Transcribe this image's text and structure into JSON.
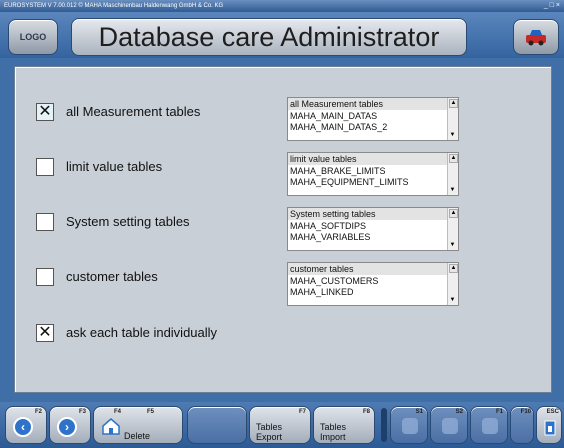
{
  "window": {
    "titlebar": "EUROSYSTEM V 7.00.012 © MAHA Maschinenbau Haldenwang GmbH & Co. KG",
    "controls": "_ □ ×"
  },
  "header": {
    "logo_label": "LOGO",
    "title": "Database care Administrator",
    "car_icon": "car-icon"
  },
  "options": [
    {
      "checked": true,
      "mark": "✕",
      "label": "all Measurement tables",
      "list_header": "all Measurement tables",
      "list_items": [
        "MAHA_MAIN_DATAS",
        "MAHA_MAIN_DATAS_2"
      ]
    },
    {
      "checked": false,
      "mark": "",
      "label": "limit value tables",
      "list_header": "limit value tables",
      "list_items": [
        "MAHA_BRAKE_LIMITS",
        "MAHA_EQUIPMENT_LIMITS"
      ]
    },
    {
      "checked": false,
      "mark": "",
      "label": "System setting tables",
      "list_header": "System setting tables",
      "list_items": [
        "MAHA_SOFTDIPS",
        "MAHA_VARIABLES"
      ]
    },
    {
      "checked": false,
      "mark": "",
      "label": "customer tables",
      "list_header": "customer tables",
      "list_items": [
        "MAHA_CUSTOMERS",
        "MAHA_LINKED"
      ]
    }
  ],
  "ask_each": {
    "checked": true,
    "mark": "✕",
    "label": "ask each table individually"
  },
  "footer": {
    "f2": {
      "key": "F2",
      "icon": "back-arrow-icon",
      "glyph": "‹"
    },
    "f3": {
      "key": "F3",
      "icon": "forward-arrow-icon",
      "glyph": "›"
    },
    "f4": {
      "key": "F4",
      "icon": "home-icon"
    },
    "f5": {
      "key": "F5",
      "label": "Delete"
    },
    "f7": {
      "key": "F7",
      "label1": "Tables",
      "label2": "Export"
    },
    "f8": {
      "key": "F8",
      "label1": "Tables",
      "label2": "Import"
    },
    "disabled_keys": [
      "S1",
      "S2",
      "F1",
      "F10"
    ],
    "esc": {
      "key": "ESC",
      "icon": "exit-icon"
    }
  }
}
